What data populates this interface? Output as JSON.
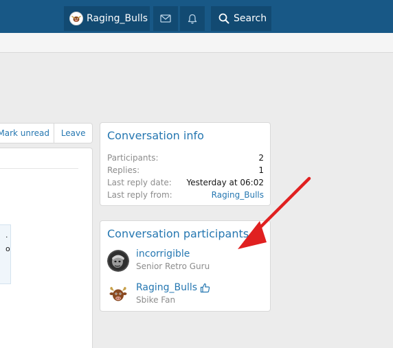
{
  "header": {
    "username": "Raging_Bulls",
    "search_label": "Search",
    "icons": {
      "inbox": "envelope-icon",
      "alerts": "bell-icon",
      "search": "search-icon"
    }
  },
  "actions": {
    "mark_unread": "Mark unread",
    "leave": "Leave"
  },
  "message_fragment": {
    "line1": ".",
    "line2": "o"
  },
  "conversation_info": {
    "title": "Conversation info",
    "rows": [
      {
        "label": "Participants:",
        "value": "2"
      },
      {
        "label": "Replies:",
        "value": "1"
      },
      {
        "label": "Last reply date:",
        "value": "Yesterday at 06:02"
      },
      {
        "label": "Last reply from:",
        "value": "Raging_Bulls"
      }
    ]
  },
  "conversation_participants": {
    "title": "Conversation participants",
    "participants": [
      {
        "name": "incorrigible",
        "title": "Senior Retro Guru"
      },
      {
        "name": "Raging_Bulls",
        "title": "Sbike Fan"
      }
    ]
  },
  "colors": {
    "topbar": "#185886",
    "nav_button": "#124a72",
    "link": "#2577b1",
    "muted": "#8c8c8c",
    "annotation_arrow": "#e02020"
  }
}
